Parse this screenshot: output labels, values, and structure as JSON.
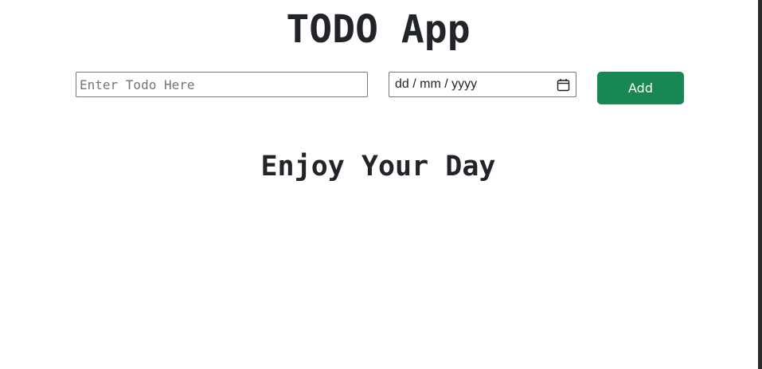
{
  "app": {
    "title": "TODO App"
  },
  "form": {
    "todo_placeholder": "Enter Todo Here",
    "todo_value": "",
    "date_placeholder": "dd / mm / yyyy",
    "add_label": "Add",
    "add_color": "#198754"
  },
  "icons": {
    "calendar": "calendar-icon"
  },
  "main": {
    "empty_message": "Enjoy Your Day"
  }
}
